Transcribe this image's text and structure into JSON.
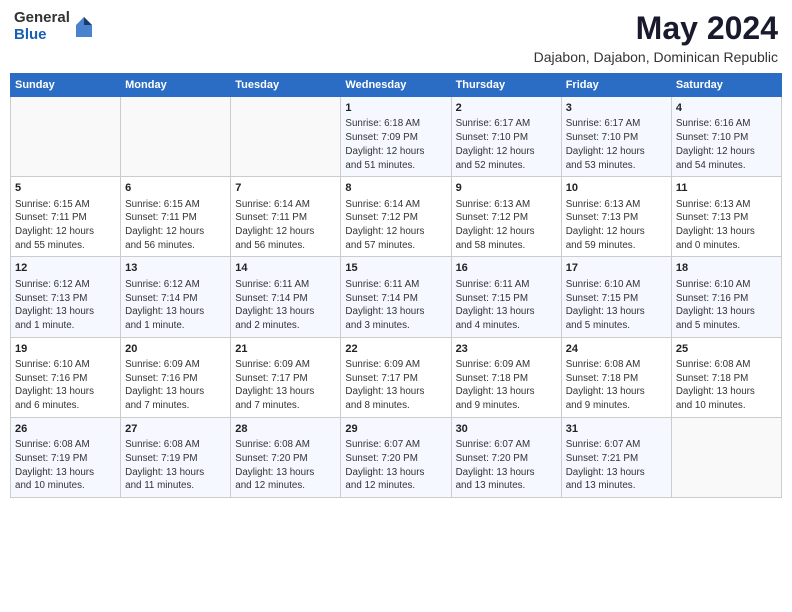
{
  "header": {
    "logo_general": "General",
    "logo_blue": "Blue",
    "month_year": "May 2024",
    "location": "Dajabon, Dajabon, Dominican Republic"
  },
  "weekdays": [
    "Sunday",
    "Monday",
    "Tuesday",
    "Wednesday",
    "Thursday",
    "Friday",
    "Saturday"
  ],
  "weeks": [
    [
      {
        "day": "",
        "info": ""
      },
      {
        "day": "",
        "info": ""
      },
      {
        "day": "",
        "info": ""
      },
      {
        "day": "1",
        "info": "Sunrise: 6:18 AM\nSunset: 7:09 PM\nDaylight: 12 hours\nand 51 minutes."
      },
      {
        "day": "2",
        "info": "Sunrise: 6:17 AM\nSunset: 7:10 PM\nDaylight: 12 hours\nand 52 minutes."
      },
      {
        "day": "3",
        "info": "Sunrise: 6:17 AM\nSunset: 7:10 PM\nDaylight: 12 hours\nand 53 minutes."
      },
      {
        "day": "4",
        "info": "Sunrise: 6:16 AM\nSunset: 7:10 PM\nDaylight: 12 hours\nand 54 minutes."
      }
    ],
    [
      {
        "day": "5",
        "info": "Sunrise: 6:15 AM\nSunset: 7:11 PM\nDaylight: 12 hours\nand 55 minutes."
      },
      {
        "day": "6",
        "info": "Sunrise: 6:15 AM\nSunset: 7:11 PM\nDaylight: 12 hours\nand 56 minutes."
      },
      {
        "day": "7",
        "info": "Sunrise: 6:14 AM\nSunset: 7:11 PM\nDaylight: 12 hours\nand 56 minutes."
      },
      {
        "day": "8",
        "info": "Sunrise: 6:14 AM\nSunset: 7:12 PM\nDaylight: 12 hours\nand 57 minutes."
      },
      {
        "day": "9",
        "info": "Sunrise: 6:13 AM\nSunset: 7:12 PM\nDaylight: 12 hours\nand 58 minutes."
      },
      {
        "day": "10",
        "info": "Sunrise: 6:13 AM\nSunset: 7:13 PM\nDaylight: 12 hours\nand 59 minutes."
      },
      {
        "day": "11",
        "info": "Sunrise: 6:13 AM\nSunset: 7:13 PM\nDaylight: 13 hours\nand 0 minutes."
      }
    ],
    [
      {
        "day": "12",
        "info": "Sunrise: 6:12 AM\nSunset: 7:13 PM\nDaylight: 13 hours\nand 1 minute."
      },
      {
        "day": "13",
        "info": "Sunrise: 6:12 AM\nSunset: 7:14 PM\nDaylight: 13 hours\nand 1 minute."
      },
      {
        "day": "14",
        "info": "Sunrise: 6:11 AM\nSunset: 7:14 PM\nDaylight: 13 hours\nand 2 minutes."
      },
      {
        "day": "15",
        "info": "Sunrise: 6:11 AM\nSunset: 7:14 PM\nDaylight: 13 hours\nand 3 minutes."
      },
      {
        "day": "16",
        "info": "Sunrise: 6:11 AM\nSunset: 7:15 PM\nDaylight: 13 hours\nand 4 minutes."
      },
      {
        "day": "17",
        "info": "Sunrise: 6:10 AM\nSunset: 7:15 PM\nDaylight: 13 hours\nand 5 minutes."
      },
      {
        "day": "18",
        "info": "Sunrise: 6:10 AM\nSunset: 7:16 PM\nDaylight: 13 hours\nand 5 minutes."
      }
    ],
    [
      {
        "day": "19",
        "info": "Sunrise: 6:10 AM\nSunset: 7:16 PM\nDaylight: 13 hours\nand 6 minutes."
      },
      {
        "day": "20",
        "info": "Sunrise: 6:09 AM\nSunset: 7:16 PM\nDaylight: 13 hours\nand 7 minutes."
      },
      {
        "day": "21",
        "info": "Sunrise: 6:09 AM\nSunset: 7:17 PM\nDaylight: 13 hours\nand 7 minutes."
      },
      {
        "day": "22",
        "info": "Sunrise: 6:09 AM\nSunset: 7:17 PM\nDaylight: 13 hours\nand 8 minutes."
      },
      {
        "day": "23",
        "info": "Sunrise: 6:09 AM\nSunset: 7:18 PM\nDaylight: 13 hours\nand 9 minutes."
      },
      {
        "day": "24",
        "info": "Sunrise: 6:08 AM\nSunset: 7:18 PM\nDaylight: 13 hours\nand 9 minutes."
      },
      {
        "day": "25",
        "info": "Sunrise: 6:08 AM\nSunset: 7:18 PM\nDaylight: 13 hours\nand 10 minutes."
      }
    ],
    [
      {
        "day": "26",
        "info": "Sunrise: 6:08 AM\nSunset: 7:19 PM\nDaylight: 13 hours\nand 10 minutes."
      },
      {
        "day": "27",
        "info": "Sunrise: 6:08 AM\nSunset: 7:19 PM\nDaylight: 13 hours\nand 11 minutes."
      },
      {
        "day": "28",
        "info": "Sunrise: 6:08 AM\nSunset: 7:20 PM\nDaylight: 13 hours\nand 12 minutes."
      },
      {
        "day": "29",
        "info": "Sunrise: 6:07 AM\nSunset: 7:20 PM\nDaylight: 13 hours\nand 12 minutes."
      },
      {
        "day": "30",
        "info": "Sunrise: 6:07 AM\nSunset: 7:20 PM\nDaylight: 13 hours\nand 13 minutes."
      },
      {
        "day": "31",
        "info": "Sunrise: 6:07 AM\nSunset: 7:21 PM\nDaylight: 13 hours\nand 13 minutes."
      },
      {
        "day": "",
        "info": ""
      }
    ]
  ]
}
